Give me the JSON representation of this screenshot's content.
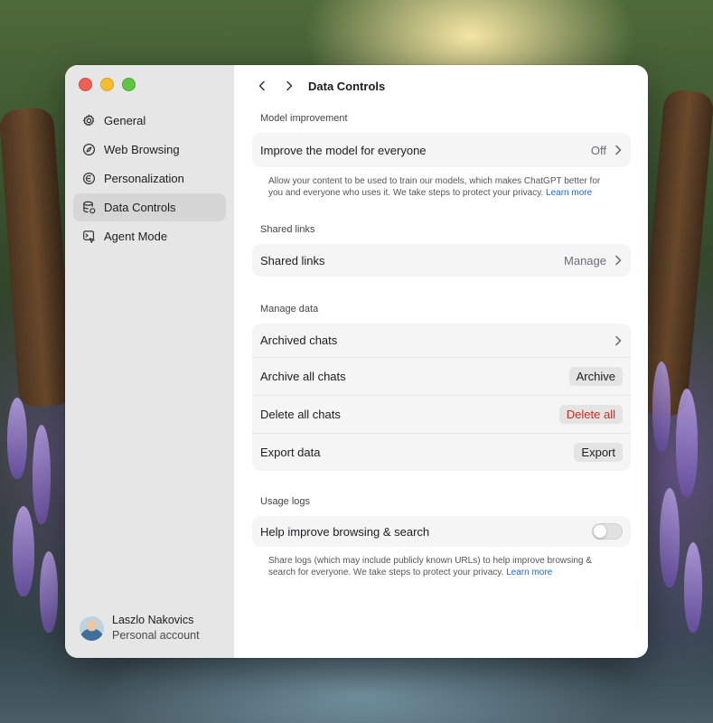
{
  "sidebar": {
    "items": [
      {
        "label": "General",
        "icon": "gear-icon"
      },
      {
        "label": "Web Browsing",
        "icon": "compass-icon"
      },
      {
        "label": "Personalization",
        "icon": "personalization-icon"
      },
      {
        "label": "Data Controls",
        "icon": "database-icon",
        "active": true
      },
      {
        "label": "Agent Mode",
        "icon": "agent-icon"
      }
    ],
    "account": {
      "name": "Laszlo Nakovics",
      "subtitle": "Personal account"
    }
  },
  "header": {
    "title": "Data Controls"
  },
  "sections": {
    "model": {
      "label": "Model improvement",
      "row_label": "Improve the model for everyone",
      "row_value": "Off",
      "description": "Allow your content to be used to train our models, which makes ChatGPT better for you and everyone who uses it. We take steps to protect your privacy.",
      "link": "Learn more"
    },
    "shared": {
      "label": "Shared links",
      "row_label": "Shared links",
      "row_value": "Manage"
    },
    "manage": {
      "label": "Manage data",
      "archived_label": "Archived chats",
      "archive_all_label": "Archive all chats",
      "archive_button": "Archive",
      "delete_all_label": "Delete all chats",
      "delete_button": "Delete all",
      "export_label": "Export data",
      "export_button": "Export"
    },
    "usage": {
      "label": "Usage logs",
      "row_label": "Help improve browsing & search",
      "toggle_on": false,
      "description": "Share logs (which may include publicly known URLs) to help improve browsing & search for everyone. We take steps to protect your privacy.",
      "link": "Learn more"
    }
  },
  "colors": {
    "accent_link": "#1769d6",
    "danger": "#d0281c",
    "active_item": "#d6d6d6"
  }
}
